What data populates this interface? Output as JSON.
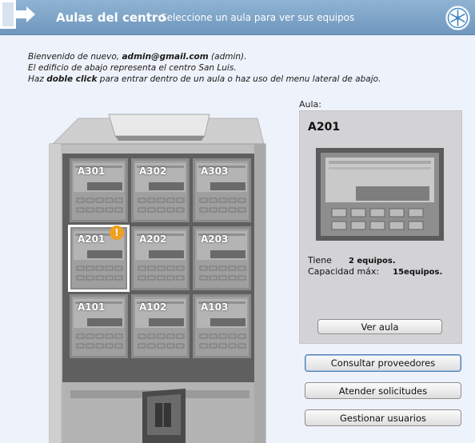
{
  "header": {
    "title": "Aulas del centro",
    "subtitle": "Seleccione un aula para ver sus equipos"
  },
  "welcome": {
    "line1_prefix": "Bienvenido de nuevo, ",
    "user_email": "admin@gmail.com",
    "line1_suffix": " (admin).",
    "line2": "El edificio de abajo representa el centro San Luis.",
    "line3_prefix": "Haz ",
    "line3_bold": "doble click",
    "line3_suffix": " para entrar dentro de un aula o haz uso del menu lateral de abajo."
  },
  "building": {
    "rooms": [
      {
        "label": "A301",
        "selected": false,
        "alert": false
      },
      {
        "label": "A302",
        "selected": false,
        "alert": false
      },
      {
        "label": "A303",
        "selected": false,
        "alert": false
      },
      {
        "label": "A201",
        "selected": true,
        "alert": true
      },
      {
        "label": "A202",
        "selected": false,
        "alert": false
      },
      {
        "label": "A203",
        "selected": false,
        "alert": false
      },
      {
        "label": "A101",
        "selected": false,
        "alert": false
      },
      {
        "label": "A102",
        "selected": false,
        "alert": false
      },
      {
        "label": "A103",
        "selected": false,
        "alert": false
      }
    ],
    "alert_symbol": "!"
  },
  "panel": {
    "caption": "Aula:",
    "room_name": "A201",
    "tiene_label": "Tiene",
    "tiene_value": "2 equipos.",
    "capacidad_label": "Capacidad máx:",
    "capacidad_value": "15equipos.",
    "ver_aula_label": "Ver aula"
  },
  "actions": {
    "consultar_label": "Consultar proveedores",
    "atender_label": "Atender solicitudes",
    "gestionar_label": "Gestionar usuarios"
  },
  "colors": {
    "header": "#7fa6c9",
    "background": "#eef2fa",
    "alert": "#f0a020",
    "panel": "#d3d3d6"
  },
  "icons": {
    "exit": "exit-door-icon",
    "logo": "snowflake-logo-icon"
  }
}
